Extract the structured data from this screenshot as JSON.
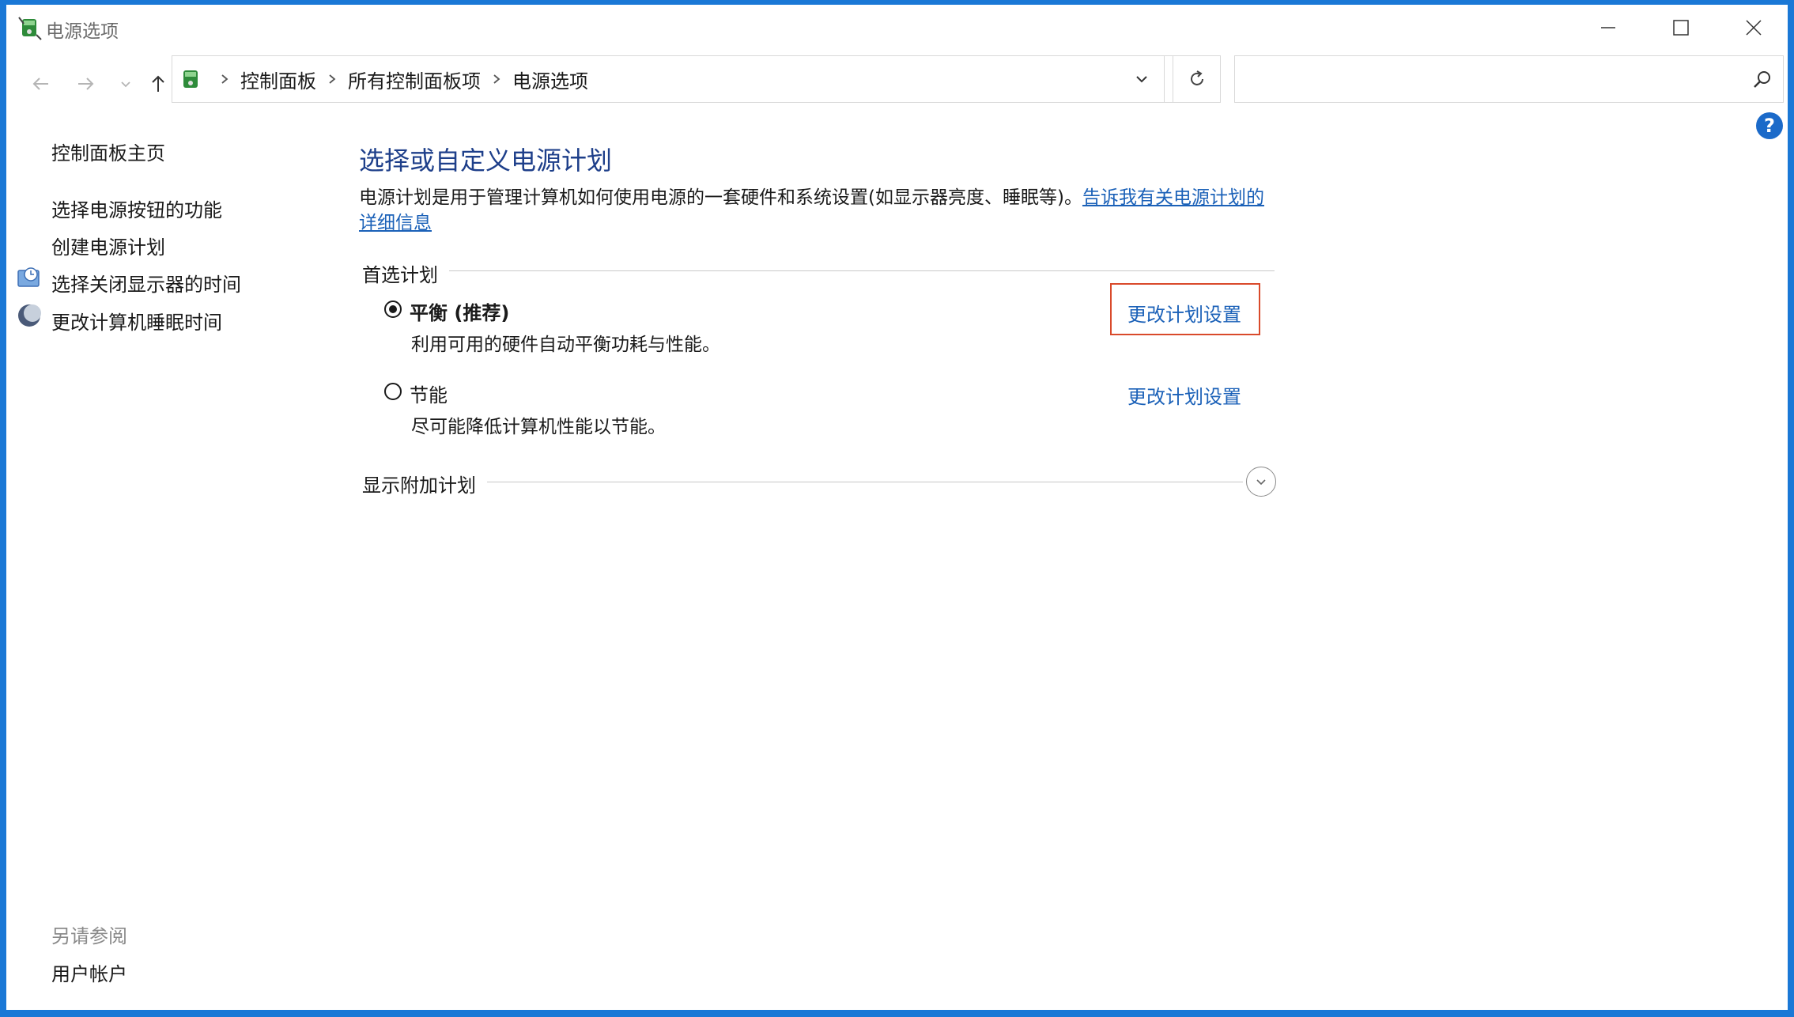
{
  "window": {
    "title": "电源选项"
  },
  "addressbar": {
    "breadcrumbs": [
      "控制面板",
      "所有控制面板项",
      "电源选项"
    ]
  },
  "search": {
    "placeholder": ""
  },
  "help": {
    "label": "?"
  },
  "left_pane": {
    "home": "控制面板主页",
    "links": [
      "选择电源按钮的功能",
      "创建电源计划",
      "选择关闭显示器的时间",
      "更改计算机睡眠时间"
    ],
    "see_also_title": "另请参阅",
    "see_also_links": [
      "用户帐户"
    ]
  },
  "main": {
    "title": "选择或自定义电源计划",
    "description": "电源计划是用于管理计算机如何使用电源的一套硬件和系统设置(如显示器亮度、睡眠等)。",
    "description_link": "告诉我有关电源计划的详细信息",
    "preferred_section": "首选计划",
    "plans": [
      {
        "name": "平衡 (推荐)",
        "description": "利用可用的硬件自动平衡功耗与性能。",
        "selected": true,
        "link": "更改计划设置"
      },
      {
        "name": "节能",
        "description": "尽可能降低计算机性能以节能。",
        "selected": false,
        "link": "更改计划设置"
      }
    ],
    "additional_section": "显示附加计划"
  },
  "colors": {
    "title_blue": "#1e3f8a",
    "link_blue": "#1b61b8",
    "highlight_red": "#d94a2b",
    "desktop_blue": "#1a78d6"
  }
}
